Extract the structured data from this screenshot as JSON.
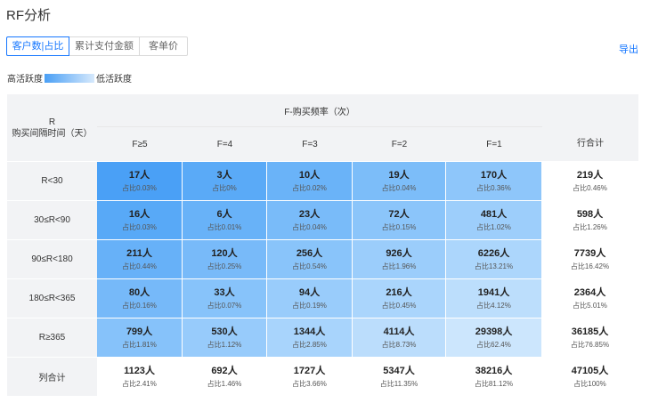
{
  "title": "RF分析",
  "tabs": [
    {
      "label": "客户数|占比",
      "active": true
    },
    {
      "label": "累计支付金额",
      "active": false
    },
    {
      "label": "客单价",
      "active": false
    }
  ],
  "export_label": "导出",
  "legend": {
    "high": "高活跃度",
    "low": "低活跃度",
    "high_color": "#4a9ff5",
    "low_color": "#d6e9fc"
  },
  "table": {
    "r_header_line1": "R",
    "r_header_line2": "购买间隔时间（天）",
    "f_header": "F-购买频率（次）",
    "f_columns": [
      "F≥5",
      "F=4",
      "F=3",
      "F=2",
      "F=1"
    ],
    "row_total_header": "行合计",
    "rows": [
      {
        "label": "R<30",
        "cells": [
          {
            "n": "17人",
            "p": "占比0.03%",
            "bg": "#4aa0f6"
          },
          {
            "n": "3人",
            "p": "占比0%",
            "bg": "#5aaaf7"
          },
          {
            "n": "10人",
            "p": "占比0.02%",
            "bg": "#6ab3f8"
          },
          {
            "n": "19人",
            "p": "占比0.04%",
            "bg": "#7cbdf9"
          },
          {
            "n": "170人",
            "p": "占比0.36%",
            "bg": "#8ec6fa"
          }
        ],
        "total": {
          "n": "219人",
          "p": "占比0.46%"
        }
      },
      {
        "label": "30≤R<90",
        "cells": [
          {
            "n": "16人",
            "p": "占比0.03%",
            "bg": "#58a9f7"
          },
          {
            "n": "6人",
            "p": "占比0.01%",
            "bg": "#68b2f8"
          },
          {
            "n": "23人",
            "p": "占比0.04%",
            "bg": "#79bbf9"
          },
          {
            "n": "72人",
            "p": "占比0.15%",
            "bg": "#8bc5fa"
          },
          {
            "n": "481人",
            "p": "占比1.02%",
            "bg": "#9dcefb"
          }
        ],
        "total": {
          "n": "598人",
          "p": "占比1.26%"
        }
      },
      {
        "label": "90≤R<180",
        "cells": [
          {
            "n": "211人",
            "p": "占比0.44%",
            "bg": "#67b1f8"
          },
          {
            "n": "120人",
            "p": "占比0.25%",
            "bg": "#78baf9"
          },
          {
            "n": "256人",
            "p": "占比0.54%",
            "bg": "#89c4fa"
          },
          {
            "n": "926人",
            "p": "占比1.96%",
            "bg": "#9bcdfb"
          },
          {
            "n": "6226人",
            "p": "占比13.21%",
            "bg": "#acd6fc"
          }
        ],
        "total": {
          "n": "7739人",
          "p": "占比16.42%"
        }
      },
      {
        "label": "180≤R<365",
        "cells": [
          {
            "n": "80人",
            "p": "占比0.16%",
            "bg": "#76b9f9"
          },
          {
            "n": "33人",
            "p": "占比0.07%",
            "bg": "#87c3fa"
          },
          {
            "n": "94人",
            "p": "占比0.19%",
            "bg": "#99ccfb"
          },
          {
            "n": "216人",
            "p": "占比0.45%",
            "bg": "#aad5fc"
          },
          {
            "n": "1941人",
            "p": "占比4.12%",
            "bg": "#bcdefc"
          }
        ],
        "total": {
          "n": "2364人",
          "p": "占比5.01%"
        }
      },
      {
        "label": "R≥365",
        "cells": [
          {
            "n": "799人",
            "p": "占比1.81%",
            "bg": "#86c2fa"
          },
          {
            "n": "530人",
            "p": "占比1.12%",
            "bg": "#97cbfb"
          },
          {
            "n": "1344人",
            "p": "占比2.85%",
            "bg": "#a8d4fc"
          },
          {
            "n": "4114人",
            "p": "占比8.73%",
            "bg": "#bbddfc"
          },
          {
            "n": "29398人",
            "p": "占比62.4%",
            "bg": "#cce6fd"
          }
        ],
        "total": {
          "n": "36185人",
          "p": "占比76.85%"
        }
      }
    ],
    "column_total_label": "列合计",
    "column_totals": [
      {
        "n": "1123人",
        "p": "占比2.41%"
      },
      {
        "n": "692人",
        "p": "占比1.46%"
      },
      {
        "n": "1727人",
        "p": "占比3.66%"
      },
      {
        "n": "5347人",
        "p": "占比11.35%"
      },
      {
        "n": "38216人",
        "p": "占比81.12%"
      }
    ],
    "grand_total": {
      "n": "47105人",
      "p": "占比100%"
    }
  }
}
